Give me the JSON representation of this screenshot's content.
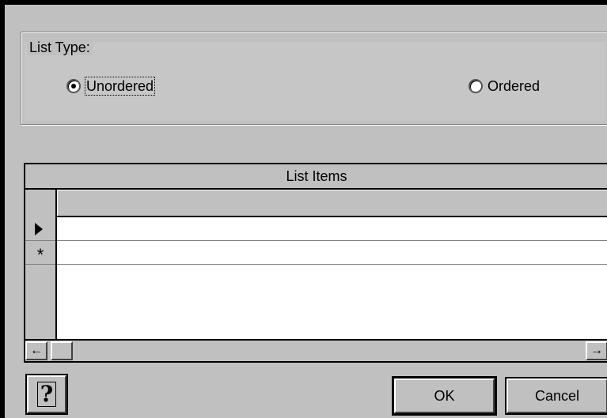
{
  "list_type_group": {
    "legend": "List Type:",
    "options": [
      {
        "label": "Unordered",
        "selected": true
      },
      {
        "label": "Ordered",
        "selected": false
      }
    ]
  },
  "grid": {
    "caption": "List Items",
    "rows": [
      {
        "selector": "current",
        "value": ""
      },
      {
        "selector": "new",
        "selector_glyph": "*",
        "value": ""
      }
    ]
  },
  "scrollbar": {
    "left_arrow": "←",
    "right_arrow": "→"
  },
  "buttons": {
    "help_glyph": "?",
    "ok": "OK",
    "cancel": "Cancel"
  },
  "icons": {
    "help": "help-icon",
    "current_row": "current-row-arrow-icon",
    "new_row": "new-row-asterisk-icon"
  }
}
